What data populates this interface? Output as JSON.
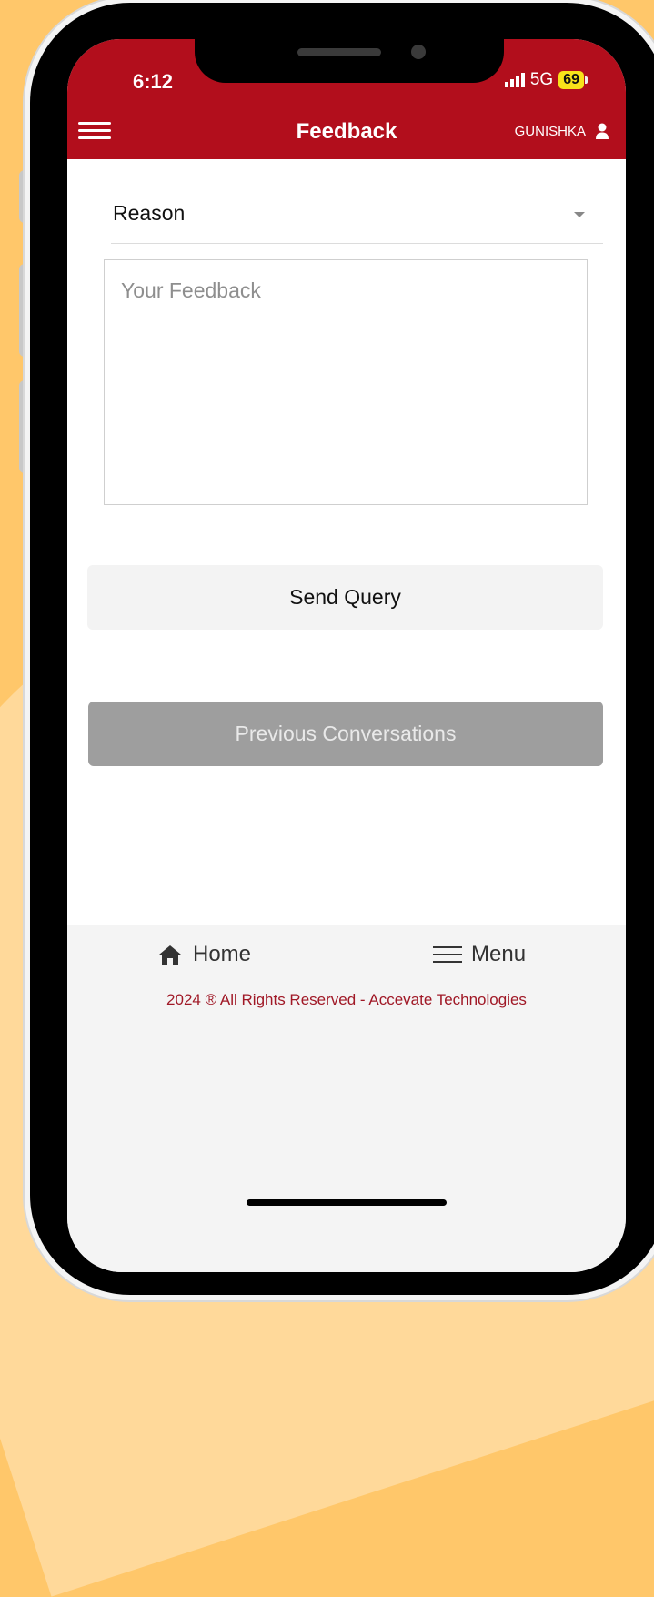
{
  "status_bar": {
    "time": "6:12",
    "network": "5G",
    "battery": "69"
  },
  "header": {
    "title": "Feedback",
    "user_name": "GUNISHKA"
  },
  "form": {
    "reason_label": "Reason",
    "feedback_placeholder": "Your Feedback",
    "feedback_value": "",
    "send_label": "Send Query"
  },
  "previous_label": "Previous Conversations",
  "footer": {
    "home_label": "Home",
    "menu_label": "Menu",
    "copyright": "2024 ® All Rights Reserved - Accevate Technologies"
  },
  "colors": {
    "brand": "#b20e1c",
    "background": "#ffc76a",
    "disabled_button": "#9e9e9e"
  }
}
